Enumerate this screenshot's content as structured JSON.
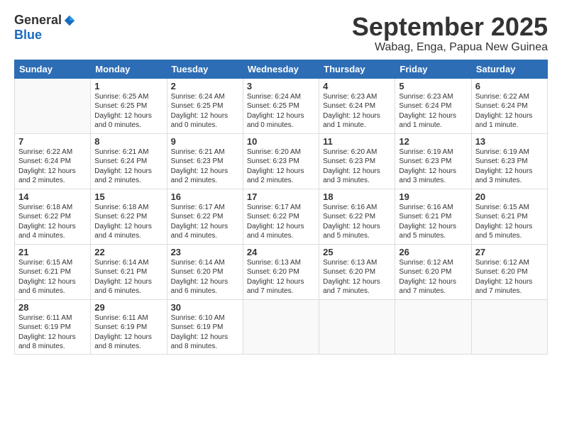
{
  "logo": {
    "general": "General",
    "blue": "Blue"
  },
  "title": {
    "month": "September 2025",
    "location": "Wabag, Enga, Papua New Guinea"
  },
  "headers": [
    "Sunday",
    "Monday",
    "Tuesday",
    "Wednesday",
    "Thursday",
    "Friday",
    "Saturday"
  ],
  "weeks": [
    [
      {
        "day": "",
        "info": ""
      },
      {
        "day": "1",
        "info": "Sunrise: 6:25 AM\nSunset: 6:25 PM\nDaylight: 12 hours\nand 0 minutes."
      },
      {
        "day": "2",
        "info": "Sunrise: 6:24 AM\nSunset: 6:25 PM\nDaylight: 12 hours\nand 0 minutes."
      },
      {
        "day": "3",
        "info": "Sunrise: 6:24 AM\nSunset: 6:25 PM\nDaylight: 12 hours\nand 0 minutes."
      },
      {
        "day": "4",
        "info": "Sunrise: 6:23 AM\nSunset: 6:24 PM\nDaylight: 12 hours\nand 1 minute."
      },
      {
        "day": "5",
        "info": "Sunrise: 6:23 AM\nSunset: 6:24 PM\nDaylight: 12 hours\nand 1 minute."
      },
      {
        "day": "6",
        "info": "Sunrise: 6:22 AM\nSunset: 6:24 PM\nDaylight: 12 hours\nand 1 minute."
      }
    ],
    [
      {
        "day": "7",
        "info": "Sunrise: 6:22 AM\nSunset: 6:24 PM\nDaylight: 12 hours\nand 2 minutes."
      },
      {
        "day": "8",
        "info": "Sunrise: 6:21 AM\nSunset: 6:24 PM\nDaylight: 12 hours\nand 2 minutes."
      },
      {
        "day": "9",
        "info": "Sunrise: 6:21 AM\nSunset: 6:23 PM\nDaylight: 12 hours\nand 2 minutes."
      },
      {
        "day": "10",
        "info": "Sunrise: 6:20 AM\nSunset: 6:23 PM\nDaylight: 12 hours\nand 2 minutes."
      },
      {
        "day": "11",
        "info": "Sunrise: 6:20 AM\nSunset: 6:23 PM\nDaylight: 12 hours\nand 3 minutes."
      },
      {
        "day": "12",
        "info": "Sunrise: 6:19 AM\nSunset: 6:23 PM\nDaylight: 12 hours\nand 3 minutes."
      },
      {
        "day": "13",
        "info": "Sunrise: 6:19 AM\nSunset: 6:23 PM\nDaylight: 12 hours\nand 3 minutes."
      }
    ],
    [
      {
        "day": "14",
        "info": "Sunrise: 6:18 AM\nSunset: 6:22 PM\nDaylight: 12 hours\nand 4 minutes."
      },
      {
        "day": "15",
        "info": "Sunrise: 6:18 AM\nSunset: 6:22 PM\nDaylight: 12 hours\nand 4 minutes."
      },
      {
        "day": "16",
        "info": "Sunrise: 6:17 AM\nSunset: 6:22 PM\nDaylight: 12 hours\nand 4 minutes."
      },
      {
        "day": "17",
        "info": "Sunrise: 6:17 AM\nSunset: 6:22 PM\nDaylight: 12 hours\nand 4 minutes."
      },
      {
        "day": "18",
        "info": "Sunrise: 6:16 AM\nSunset: 6:22 PM\nDaylight: 12 hours\nand 5 minutes."
      },
      {
        "day": "19",
        "info": "Sunrise: 6:16 AM\nSunset: 6:21 PM\nDaylight: 12 hours\nand 5 minutes."
      },
      {
        "day": "20",
        "info": "Sunrise: 6:15 AM\nSunset: 6:21 PM\nDaylight: 12 hours\nand 5 minutes."
      }
    ],
    [
      {
        "day": "21",
        "info": "Sunrise: 6:15 AM\nSunset: 6:21 PM\nDaylight: 12 hours\nand 6 minutes."
      },
      {
        "day": "22",
        "info": "Sunrise: 6:14 AM\nSunset: 6:21 PM\nDaylight: 12 hours\nand 6 minutes."
      },
      {
        "day": "23",
        "info": "Sunrise: 6:14 AM\nSunset: 6:20 PM\nDaylight: 12 hours\nand 6 minutes."
      },
      {
        "day": "24",
        "info": "Sunrise: 6:13 AM\nSunset: 6:20 PM\nDaylight: 12 hours\nand 7 minutes."
      },
      {
        "day": "25",
        "info": "Sunrise: 6:13 AM\nSunset: 6:20 PM\nDaylight: 12 hours\nand 7 minutes."
      },
      {
        "day": "26",
        "info": "Sunrise: 6:12 AM\nSunset: 6:20 PM\nDaylight: 12 hours\nand 7 minutes."
      },
      {
        "day": "27",
        "info": "Sunrise: 6:12 AM\nSunset: 6:20 PM\nDaylight: 12 hours\nand 7 minutes."
      }
    ],
    [
      {
        "day": "28",
        "info": "Sunrise: 6:11 AM\nSunset: 6:19 PM\nDaylight: 12 hours\nand 8 minutes."
      },
      {
        "day": "29",
        "info": "Sunrise: 6:11 AM\nSunset: 6:19 PM\nDaylight: 12 hours\nand 8 minutes."
      },
      {
        "day": "30",
        "info": "Sunrise: 6:10 AM\nSunset: 6:19 PM\nDaylight: 12 hours\nand 8 minutes."
      },
      {
        "day": "",
        "info": ""
      },
      {
        "day": "",
        "info": ""
      },
      {
        "day": "",
        "info": ""
      },
      {
        "day": "",
        "info": ""
      }
    ]
  ]
}
